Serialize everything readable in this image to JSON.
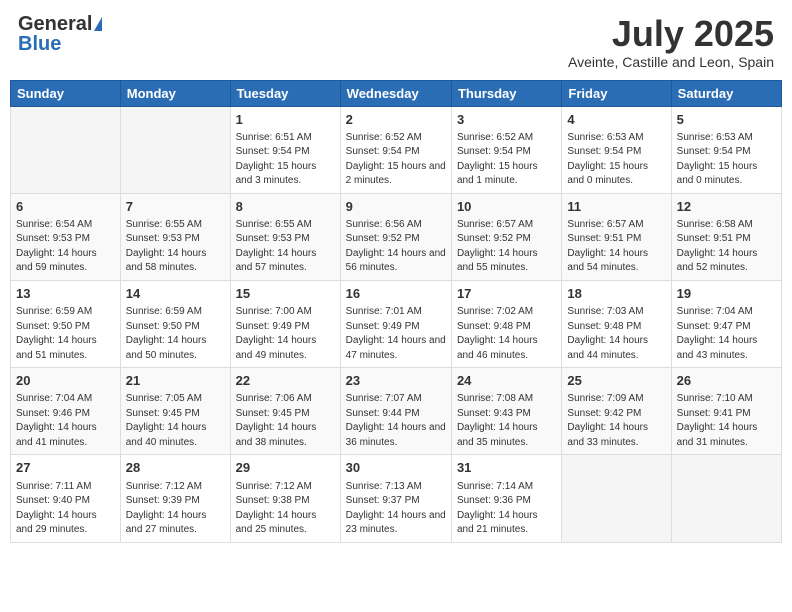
{
  "logo": {
    "general": "General",
    "blue": "Blue"
  },
  "title": "July 2025",
  "location": "Aveinte, Castille and Leon, Spain",
  "weekdays": [
    "Sunday",
    "Monday",
    "Tuesday",
    "Wednesday",
    "Thursday",
    "Friday",
    "Saturday"
  ],
  "weeks": [
    [
      {
        "day": "",
        "sunrise": "",
        "sunset": "",
        "daylight": ""
      },
      {
        "day": "",
        "sunrise": "",
        "sunset": "",
        "daylight": ""
      },
      {
        "day": "1",
        "sunrise": "Sunrise: 6:51 AM",
        "sunset": "Sunset: 9:54 PM",
        "daylight": "Daylight: 15 hours and 3 minutes."
      },
      {
        "day": "2",
        "sunrise": "Sunrise: 6:52 AM",
        "sunset": "Sunset: 9:54 PM",
        "daylight": "Daylight: 15 hours and 2 minutes."
      },
      {
        "day": "3",
        "sunrise": "Sunrise: 6:52 AM",
        "sunset": "Sunset: 9:54 PM",
        "daylight": "Daylight: 15 hours and 1 minute."
      },
      {
        "day": "4",
        "sunrise": "Sunrise: 6:53 AM",
        "sunset": "Sunset: 9:54 PM",
        "daylight": "Daylight: 15 hours and 0 minutes."
      },
      {
        "day": "5",
        "sunrise": "Sunrise: 6:53 AM",
        "sunset": "Sunset: 9:54 PM",
        "daylight": "Daylight: 15 hours and 0 minutes."
      }
    ],
    [
      {
        "day": "6",
        "sunrise": "Sunrise: 6:54 AM",
        "sunset": "Sunset: 9:53 PM",
        "daylight": "Daylight: 14 hours and 59 minutes."
      },
      {
        "day": "7",
        "sunrise": "Sunrise: 6:55 AM",
        "sunset": "Sunset: 9:53 PM",
        "daylight": "Daylight: 14 hours and 58 minutes."
      },
      {
        "day": "8",
        "sunrise": "Sunrise: 6:55 AM",
        "sunset": "Sunset: 9:53 PM",
        "daylight": "Daylight: 14 hours and 57 minutes."
      },
      {
        "day": "9",
        "sunrise": "Sunrise: 6:56 AM",
        "sunset": "Sunset: 9:52 PM",
        "daylight": "Daylight: 14 hours and 56 minutes."
      },
      {
        "day": "10",
        "sunrise": "Sunrise: 6:57 AM",
        "sunset": "Sunset: 9:52 PM",
        "daylight": "Daylight: 14 hours and 55 minutes."
      },
      {
        "day": "11",
        "sunrise": "Sunrise: 6:57 AM",
        "sunset": "Sunset: 9:51 PM",
        "daylight": "Daylight: 14 hours and 54 minutes."
      },
      {
        "day": "12",
        "sunrise": "Sunrise: 6:58 AM",
        "sunset": "Sunset: 9:51 PM",
        "daylight": "Daylight: 14 hours and 52 minutes."
      }
    ],
    [
      {
        "day": "13",
        "sunrise": "Sunrise: 6:59 AM",
        "sunset": "Sunset: 9:50 PM",
        "daylight": "Daylight: 14 hours and 51 minutes."
      },
      {
        "day": "14",
        "sunrise": "Sunrise: 6:59 AM",
        "sunset": "Sunset: 9:50 PM",
        "daylight": "Daylight: 14 hours and 50 minutes."
      },
      {
        "day": "15",
        "sunrise": "Sunrise: 7:00 AM",
        "sunset": "Sunset: 9:49 PM",
        "daylight": "Daylight: 14 hours and 49 minutes."
      },
      {
        "day": "16",
        "sunrise": "Sunrise: 7:01 AM",
        "sunset": "Sunset: 9:49 PM",
        "daylight": "Daylight: 14 hours and 47 minutes."
      },
      {
        "day": "17",
        "sunrise": "Sunrise: 7:02 AM",
        "sunset": "Sunset: 9:48 PM",
        "daylight": "Daylight: 14 hours and 46 minutes."
      },
      {
        "day": "18",
        "sunrise": "Sunrise: 7:03 AM",
        "sunset": "Sunset: 9:48 PM",
        "daylight": "Daylight: 14 hours and 44 minutes."
      },
      {
        "day": "19",
        "sunrise": "Sunrise: 7:04 AM",
        "sunset": "Sunset: 9:47 PM",
        "daylight": "Daylight: 14 hours and 43 minutes."
      }
    ],
    [
      {
        "day": "20",
        "sunrise": "Sunrise: 7:04 AM",
        "sunset": "Sunset: 9:46 PM",
        "daylight": "Daylight: 14 hours and 41 minutes."
      },
      {
        "day": "21",
        "sunrise": "Sunrise: 7:05 AM",
        "sunset": "Sunset: 9:45 PM",
        "daylight": "Daylight: 14 hours and 40 minutes."
      },
      {
        "day": "22",
        "sunrise": "Sunrise: 7:06 AM",
        "sunset": "Sunset: 9:45 PM",
        "daylight": "Daylight: 14 hours and 38 minutes."
      },
      {
        "day": "23",
        "sunrise": "Sunrise: 7:07 AM",
        "sunset": "Sunset: 9:44 PM",
        "daylight": "Daylight: 14 hours and 36 minutes."
      },
      {
        "day": "24",
        "sunrise": "Sunrise: 7:08 AM",
        "sunset": "Sunset: 9:43 PM",
        "daylight": "Daylight: 14 hours and 35 minutes."
      },
      {
        "day": "25",
        "sunrise": "Sunrise: 7:09 AM",
        "sunset": "Sunset: 9:42 PM",
        "daylight": "Daylight: 14 hours and 33 minutes."
      },
      {
        "day": "26",
        "sunrise": "Sunrise: 7:10 AM",
        "sunset": "Sunset: 9:41 PM",
        "daylight": "Daylight: 14 hours and 31 minutes."
      }
    ],
    [
      {
        "day": "27",
        "sunrise": "Sunrise: 7:11 AM",
        "sunset": "Sunset: 9:40 PM",
        "daylight": "Daylight: 14 hours and 29 minutes."
      },
      {
        "day": "28",
        "sunrise": "Sunrise: 7:12 AM",
        "sunset": "Sunset: 9:39 PM",
        "daylight": "Daylight: 14 hours and 27 minutes."
      },
      {
        "day": "29",
        "sunrise": "Sunrise: 7:12 AM",
        "sunset": "Sunset: 9:38 PM",
        "daylight": "Daylight: 14 hours and 25 minutes."
      },
      {
        "day": "30",
        "sunrise": "Sunrise: 7:13 AM",
        "sunset": "Sunset: 9:37 PM",
        "daylight": "Daylight: 14 hours and 23 minutes."
      },
      {
        "day": "31",
        "sunrise": "Sunrise: 7:14 AM",
        "sunset": "Sunset: 9:36 PM",
        "daylight": "Daylight: 14 hours and 21 minutes."
      },
      {
        "day": "",
        "sunrise": "",
        "sunset": "",
        "daylight": ""
      },
      {
        "day": "",
        "sunrise": "",
        "sunset": "",
        "daylight": ""
      }
    ]
  ]
}
